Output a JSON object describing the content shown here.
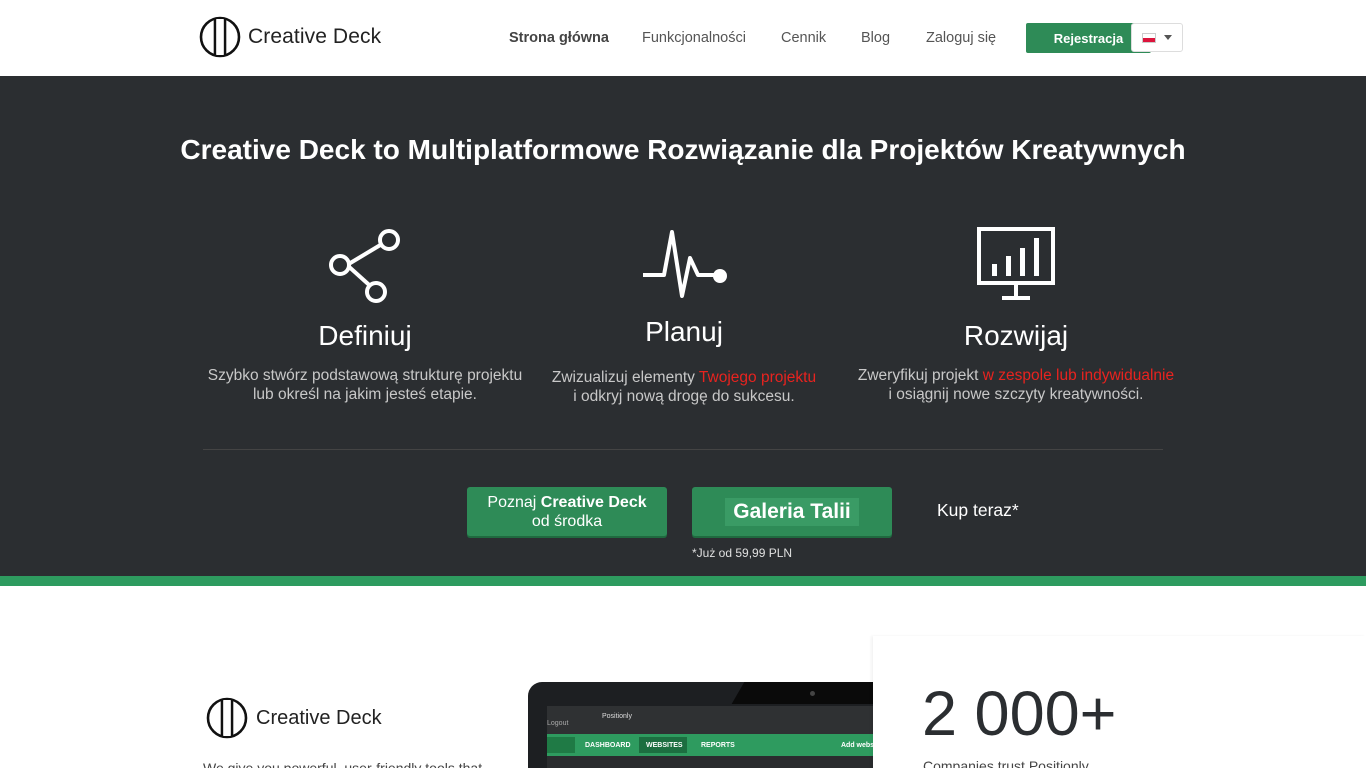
{
  "header": {
    "logo_text": "Creative Deck",
    "nav": [
      {
        "label": "Strona główna",
        "active": true
      },
      {
        "label": "Funkcjonalności",
        "active": false
      },
      {
        "label": "Cennik",
        "active": false
      },
      {
        "label": "Blog",
        "active": false
      },
      {
        "label": "Zaloguj się",
        "active": false
      }
    ],
    "register_label": "Rejestracja",
    "language_flag": "pl-flag-icon"
  },
  "hero": {
    "title_brand": "Creative Deck",
    "title_rest": " to Multiplatformowe Rozwiązanie dla Projektów Kreatywnych",
    "features": [
      {
        "icon": "share-icon",
        "title": "Definiuj",
        "line1": "Szybko stwórz podstawową strukturę projektu",
        "line1_highlight": "",
        "line2": "lub określ na jakim jesteś etapie."
      },
      {
        "icon": "pulse-icon",
        "title": "Planuj",
        "line1": "Zwizualizuj elementy ",
        "line1_highlight": "Twojego projektu",
        "line2": "i odkryj nową drogę do sukcesu."
      },
      {
        "icon": "presentation-chart-icon",
        "title": "Rozwijaj",
        "line1": "Zweryfikuj projekt ",
        "line1_highlight": "w zespole lub indywidualnie",
        "line2": "i osiągnij nowe szczyty kreatywności."
      }
    ],
    "cta_explore_prefix": "Poznaj ",
    "cta_explore_brand": "Creative Deck",
    "cta_explore_suffix": "od środka",
    "cta_gallery": "Galeria Talii",
    "buy_now": "Kup teraz*",
    "price_note": "*Już od 59,99 PLN",
    "highlight_color": "#e8231f",
    "accent_color": "#2e8b57"
  },
  "lower": {
    "logo_text": "Creative Deck",
    "description": "We give you powerful, user-friendly tools that",
    "app_screen": {
      "logout": "Logout",
      "brand": "Positionly",
      "tabs": [
        "DASHBOARD",
        "WEBSITES",
        "REPORTS"
      ],
      "add_button": "Add website"
    },
    "stats_number": "2 000+",
    "stats_label": "Companies trust Positionly"
  }
}
